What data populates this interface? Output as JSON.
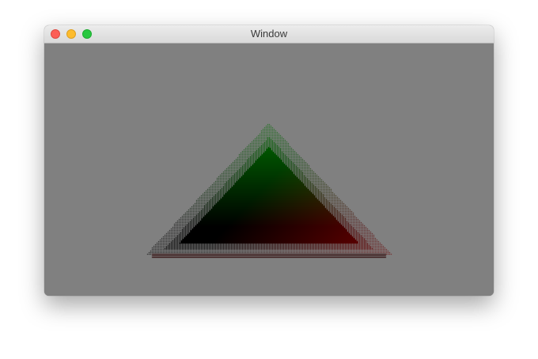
{
  "window": {
    "title": "Window",
    "background_color": "#808080",
    "controls": [
      "close",
      "minimize",
      "zoom"
    ]
  },
  "render": {
    "shape": "triangle",
    "vertex_colors": {
      "top": "#00ff00",
      "bottom_left": "#000000",
      "bottom_right": "#ff0000"
    }
  }
}
